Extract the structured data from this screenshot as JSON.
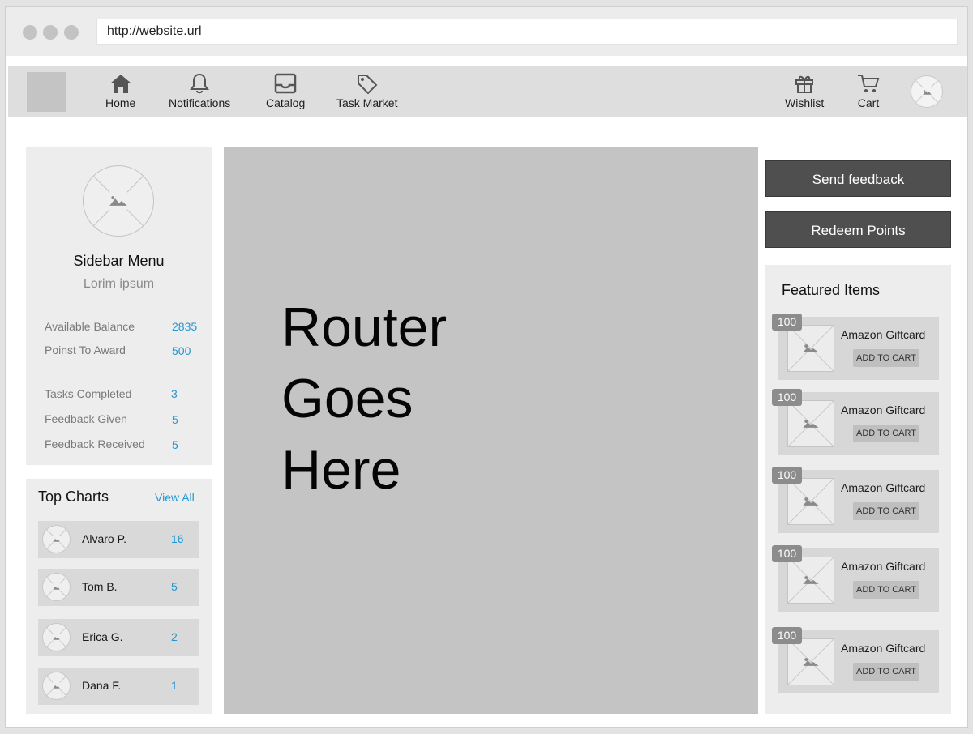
{
  "browser": {
    "url": "http://website.url"
  },
  "nav": {
    "items": [
      {
        "label": "Home",
        "icon": "home-icon"
      },
      {
        "label": "Notifications",
        "icon": "bell-icon"
      },
      {
        "label": "Catalog",
        "icon": "inbox-icon"
      },
      {
        "label": "Task Market",
        "icon": "tag-icon"
      }
    ],
    "right_items": [
      {
        "label": "Wishlist",
        "icon": "gift-icon"
      },
      {
        "label": "Cart",
        "icon": "cart-icon"
      }
    ]
  },
  "sidebar": {
    "title": "Sidebar Menu",
    "subtitle": "Lorim ipsum",
    "stats": [
      {
        "label": "Available Balance",
        "value": "2835"
      },
      {
        "label": "Poinst To Award",
        "value": "500"
      },
      {
        "label": "Tasks Completed",
        "value": "3"
      },
      {
        "label": "Feedback Given",
        "value": "5"
      },
      {
        "label": "Feedback Received",
        "value": "5"
      }
    ]
  },
  "top_charts": {
    "title": "Top Charts",
    "view_all": "View All",
    "rows": [
      {
        "name": "Alvaro P.",
        "score": "16"
      },
      {
        "name": "Tom B.",
        "score": "5"
      },
      {
        "name": "Erica G.",
        "score": "2"
      },
      {
        "name": "Dana F.",
        "score": "1"
      }
    ]
  },
  "router": {
    "line1": "Router",
    "line2": "Goes",
    "line3": "Here"
  },
  "actions": {
    "send_feedback": "Send feedback",
    "redeem_points": "Redeem Points"
  },
  "featured": {
    "title": "Featured Items",
    "items": [
      {
        "badge": "100",
        "name": "Amazon Giftcard",
        "button": "ADD TO CART"
      },
      {
        "badge": "100",
        "name": "Amazon Giftcard",
        "button": "ADD TO CART"
      },
      {
        "badge": "100",
        "name": "Amazon Giftcard",
        "button": "ADD TO CART"
      },
      {
        "badge": "100",
        "name": "Amazon Giftcard",
        "button": "ADD TO CART"
      },
      {
        "badge": "100",
        "name": "Amazon Giftcard",
        "button": "ADD TO CART"
      }
    ]
  },
  "colors": {
    "accent": "#2196d3",
    "button": "#4f4f4f",
    "router_bg": "#c4c4c4",
    "nav_bg": "#dedede"
  }
}
